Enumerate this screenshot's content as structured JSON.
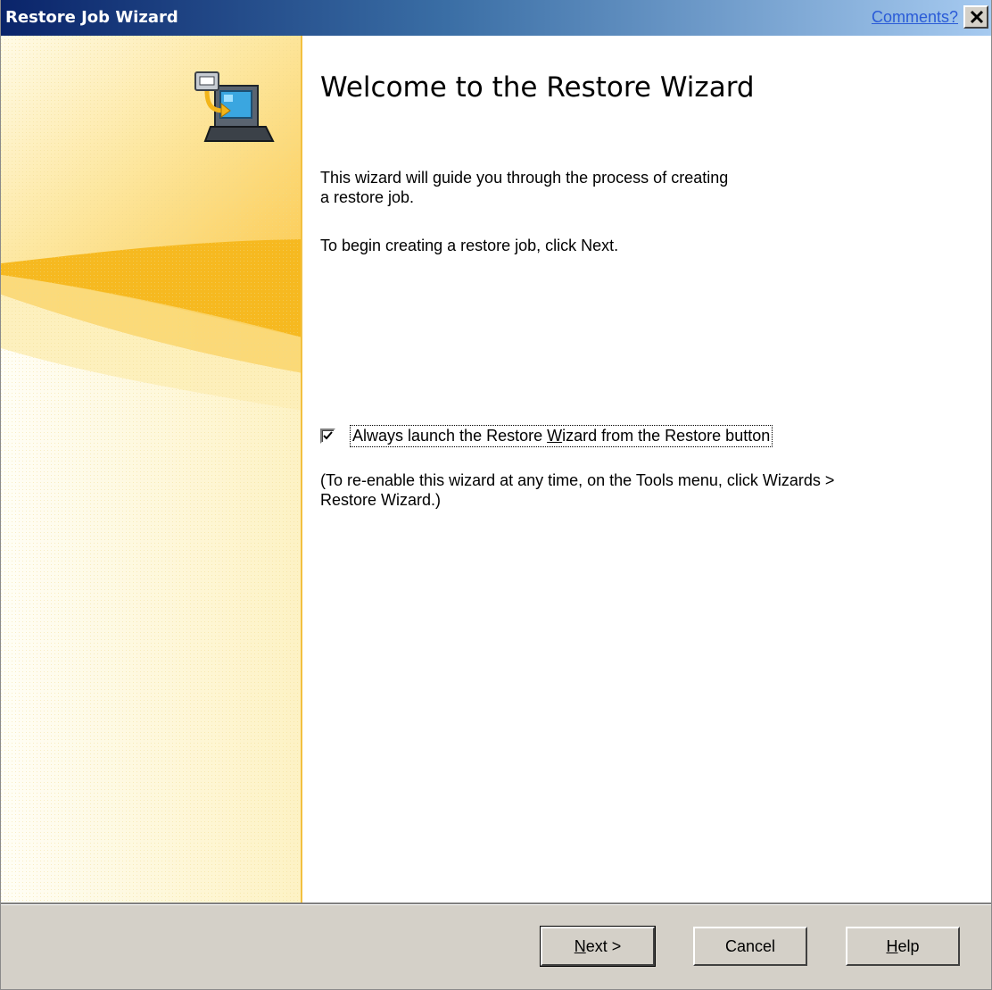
{
  "window": {
    "title": "Restore Job Wizard",
    "comments_link": "Comments?",
    "close_icon": "close-icon"
  },
  "sidebar": {
    "icon": "restore-computer-icon",
    "colors": {
      "top": "#fcd35a",
      "bottom": "#fdf9e4",
      "wave": "#f6b920",
      "border": "#f2c040"
    }
  },
  "main": {
    "heading": "Welcome to the Restore Wizard",
    "intro": "This wizard will guide you through the process of creating a restore job.",
    "instruction": "To begin creating a restore job, click Next.",
    "checkbox": {
      "label_pre": "Always launch the Restore ",
      "label_mnemonic": "W",
      "label_post": "izard from the Restore button",
      "checked": true
    },
    "reenable_note": "(To re-enable this wizard at any time, on the Tools menu, click Wizards > Restore Wizard.)"
  },
  "footer": {
    "next": {
      "mnemonic": "N",
      "rest": "ext >"
    },
    "cancel": "Cancel",
    "help": {
      "mnemonic": "H",
      "rest": "elp"
    }
  }
}
